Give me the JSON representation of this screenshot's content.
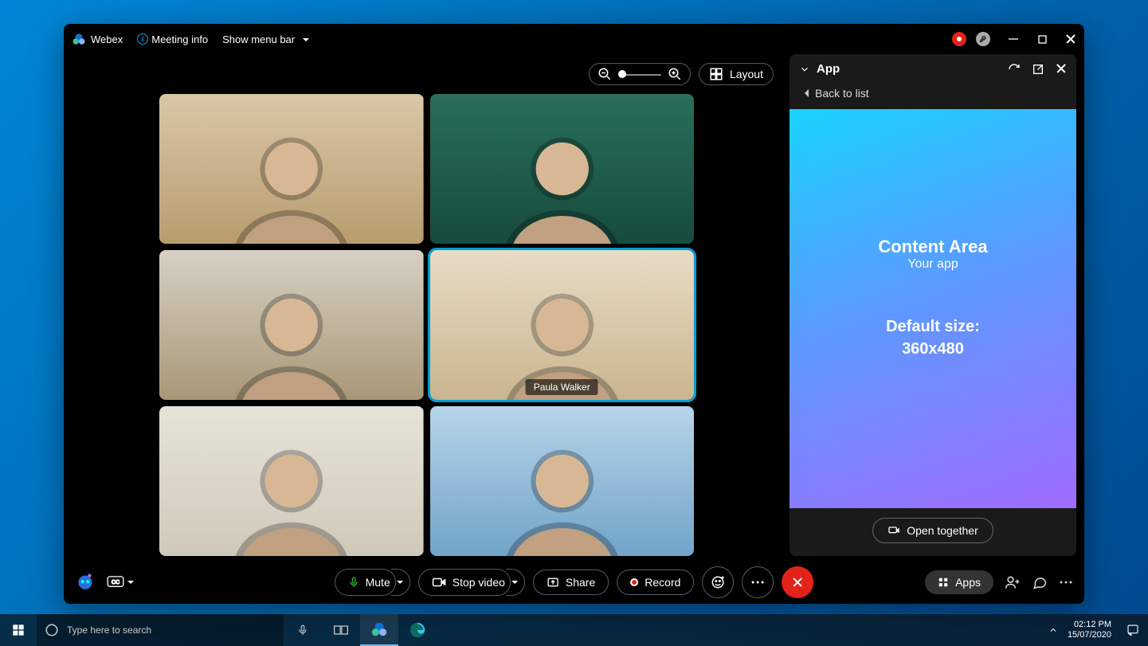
{
  "titlebar": {
    "app_name": "Webex",
    "meeting_info": "Meeting info",
    "show_menu": "Show menu bar"
  },
  "video_top": {
    "layout_label": "Layout"
  },
  "participants": [
    {
      "name": "",
      "bg1": "#d9c9a8",
      "bg2": "#b89b6e"
    },
    {
      "name": "",
      "bg1": "#2a6f5b",
      "bg2": "#164a3d"
    },
    {
      "name": "",
      "bg1": "#d7d2c6",
      "bg2": "#a79675"
    },
    {
      "name": "Paula Walker",
      "bg1": "#e8dcc6",
      "bg2": "#c9b58e",
      "active": true
    },
    {
      "name": "",
      "bg1": "#e8e4da",
      "bg2": "#cfc8b8"
    },
    {
      "name": "",
      "bg1": "#b9d5ea",
      "bg2": "#6fa3c9"
    }
  ],
  "panel": {
    "title": "App",
    "back": "Back to list",
    "content_title": "Content Area",
    "content_sub": "Your app",
    "size_label": "Default size:",
    "size_value": "360x480",
    "open_together": "Open together"
  },
  "controls": {
    "mute": "Mute",
    "stop_video": "Stop video",
    "share": "Share",
    "record": "Record",
    "apps": "Apps"
  },
  "taskbar": {
    "search_placeholder": "Type here to search",
    "time": "02:12 PM",
    "date": "15/07/2020"
  }
}
